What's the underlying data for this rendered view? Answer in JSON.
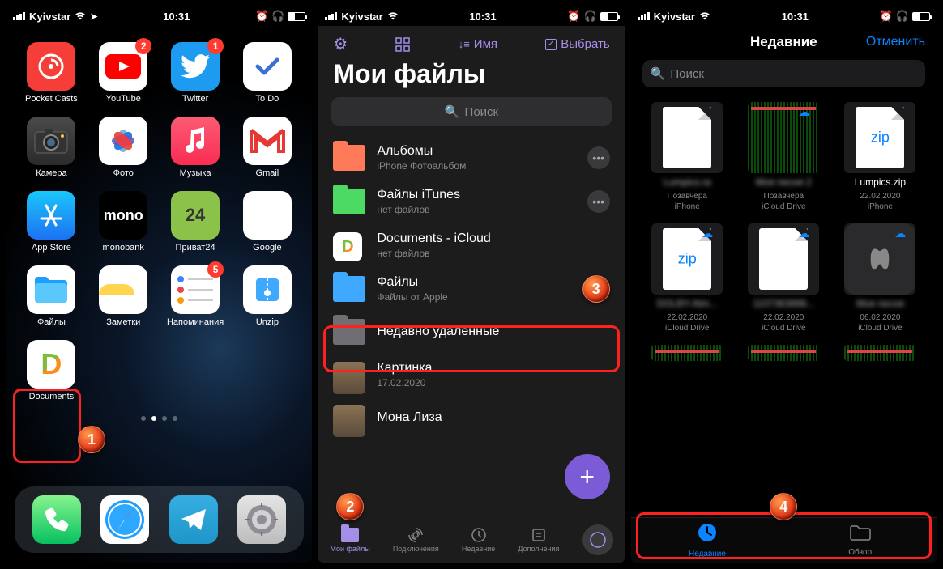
{
  "status": {
    "carrier": "Kyivstar",
    "time": "10:31"
  },
  "screen1": {
    "apps": [
      {
        "label": "Pocket Casts",
        "cls": "i-pocketcasts"
      },
      {
        "label": "YouTube",
        "cls": "i-youtube",
        "badge": "2"
      },
      {
        "label": "Twitter",
        "cls": "i-twitter",
        "badge": "1"
      },
      {
        "label": "To Do",
        "cls": "i-todo"
      },
      {
        "label": "Камера",
        "cls": "i-camera"
      },
      {
        "label": "Фото",
        "cls": "i-photos"
      },
      {
        "label": "Музыка",
        "cls": "i-music"
      },
      {
        "label": "Gmail",
        "cls": "i-gmail"
      },
      {
        "label": "App Store",
        "cls": "i-appstore"
      },
      {
        "label": "monobank",
        "cls": "i-mono"
      },
      {
        "label": "Приват24",
        "cls": "i-privat"
      },
      {
        "label": "Google",
        "cls": "i-google"
      },
      {
        "label": "Файлы",
        "cls": "i-files"
      },
      {
        "label": "Заметки",
        "cls": "i-notes"
      },
      {
        "label": "Напоминания",
        "cls": "i-reminders",
        "badge": "5"
      },
      {
        "label": "Unzip",
        "cls": "i-unzip"
      },
      {
        "label": "Documents",
        "cls": "i-documents"
      }
    ],
    "dock": [
      "i-phone",
      "i-safari",
      "i-telegram",
      "i-settings"
    ],
    "marker": "1"
  },
  "screen2": {
    "toolbar": {
      "sort": "Имя",
      "select": "Выбрать"
    },
    "title": "Мои файлы",
    "search": "Поиск",
    "folders": [
      {
        "title": "Альбомы",
        "sub": "iPhone Фотоальбом",
        "color": "#ff7a59",
        "more": true
      },
      {
        "title": "Файлы iTunes",
        "sub": "нет файлов",
        "color": "#4cd964",
        "more": true
      },
      {
        "title": "Documents - iCloud",
        "sub": "нет файлов",
        "color": "#fff",
        "docIcon": true
      },
      {
        "title": "Файлы",
        "sub": "Файлы от Apple",
        "color": "#3fa9ff",
        "highlight": true,
        "marker": "3"
      },
      {
        "title": "Недавно удаленные",
        "sub": "",
        "color": "#6e6e73"
      },
      {
        "title": "Картинка",
        "sub": "17.02.2020",
        "image": true
      },
      {
        "title": "Мона Лиза",
        "sub": "",
        "image": true
      }
    ],
    "tabs": [
      {
        "label": "Мои файлы",
        "active": true
      },
      {
        "label": "Подключения"
      },
      {
        "label": "Недавние"
      },
      {
        "label": "Дополнения"
      }
    ],
    "marker": "2"
  },
  "screen3": {
    "title": "Недавние",
    "cancel": "Отменить",
    "search": "Поиск",
    "files": [
      {
        "name": "Lumpics.ra",
        "meta1": "Позавчера",
        "meta2": "iPhone",
        "type": "doc",
        "blur": true
      },
      {
        "name": "Моя песня 2",
        "meta1": "Позавчера",
        "meta2": "iCloud Drive",
        "type": "matrix",
        "cloud": true,
        "blur": true
      },
      {
        "name": "Lumpics.zip",
        "meta1": "22.02.2020",
        "meta2": "iPhone",
        "type": "zip"
      },
      {
        "name": "DOLBY-Atm...",
        "meta1": "22.02.2020",
        "meta2": "iCloud Drive",
        "type": "zip",
        "cloud": true,
        "blur": true
      },
      {
        "name": "1107363898...",
        "meta1": "22.02.2020",
        "meta2": "iCloud Drive",
        "type": "doc",
        "cloud": true,
        "blur": true
      },
      {
        "name": "Моя песня",
        "meta1": "06.02.2020",
        "meta2": "iCloud Drive",
        "type": "gb",
        "cloud": true,
        "blur": true
      }
    ],
    "tabs": [
      {
        "label": "Недавние",
        "active": true
      },
      {
        "label": "Обзор"
      }
    ],
    "marker": "4"
  }
}
